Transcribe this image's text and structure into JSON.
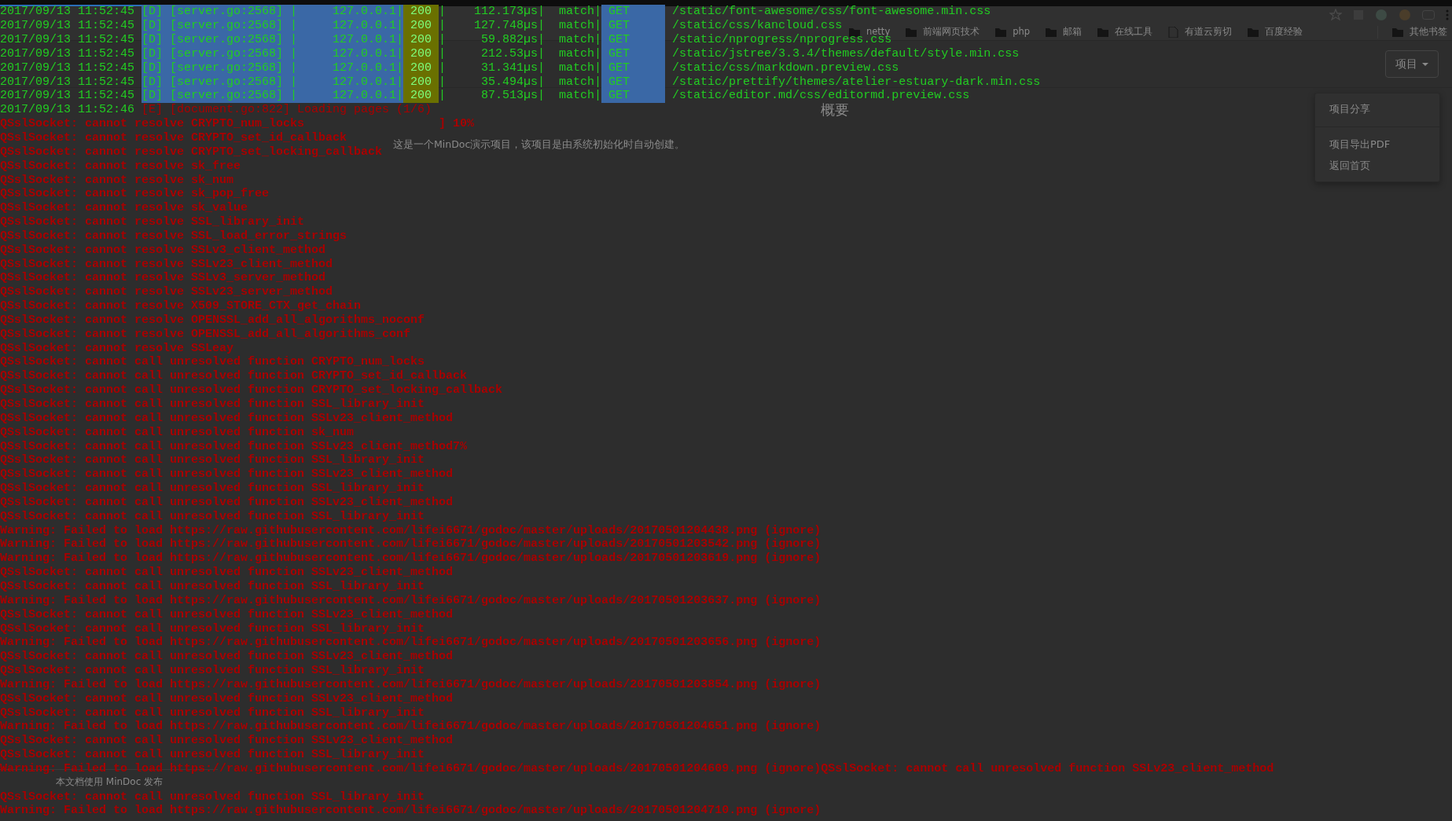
{
  "browser": {
    "bookmarks": [
      {
        "kind": "folder",
        "label": "netty"
      },
      {
        "kind": "folder",
        "label": "前端网页技术"
      },
      {
        "kind": "folder",
        "label": "php"
      },
      {
        "kind": "folder",
        "label": "邮箱"
      },
      {
        "kind": "folder",
        "label": "在线工具"
      },
      {
        "kind": "page",
        "label": "有道云剪切"
      },
      {
        "kind": "folder",
        "label": "百度经验"
      }
    ],
    "other_bookmarks": "其他书签",
    "project_button": "项目",
    "menu": [
      {
        "kind": "item",
        "label": "项目分享"
      },
      {
        "kind": "divider"
      },
      {
        "kind": "item",
        "label": "项目导出PDF"
      },
      {
        "kind": "item",
        "label": "返回首页"
      }
    ],
    "heading": "概要",
    "description": "这是一个MinDoc演示项目，该项目是由系统初始化时自动创建。",
    "footer": "本文档使用 MinDoc 发布"
  },
  "terminal": {
    "lines": [
      {
        "kind": "request",
        "time": "2017/09/13 11:52:45",
        "source": "[D] [server.go:2568] |     127.0.0.1|",
        "status": "200",
        "timing": "|    112.173µs|",
        "route": "match|",
        "method": "GET",
        "path": "/static/font-awesome/css/font-awesome.min.css"
      },
      {
        "kind": "request",
        "time": "2017/09/13 11:52:45",
        "source": "[D] [server.go:2568] |     127.0.0.1|",
        "status": "200",
        "timing": "|    127.748µs|",
        "route": "match|",
        "method": "GET",
        "path": "/static/css/kancloud.css"
      },
      {
        "kind": "request",
        "time": "2017/09/13 11:52:45",
        "source": "[D] [server.go:2568] |     127.0.0.1|",
        "status": "200",
        "timing": "|     59.882µs|",
        "route": "match|",
        "method": "GET",
        "path": "/static/nprogress/nprogress.css"
      },
      {
        "kind": "request",
        "time": "2017/09/13 11:52:45",
        "source": "[D] [server.go:2568] |     127.0.0.1|",
        "status": "200",
        "timing": "|     212.53µs|",
        "route": "match|",
        "method": "GET",
        "path": "/static/jstree/3.3.4/themes/default/style.min.css"
      },
      {
        "kind": "request",
        "time": "2017/09/13 11:52:45",
        "source": "[D] [server.go:2568] |     127.0.0.1|",
        "status": "200",
        "timing": "|     31.341µs|",
        "route": "match|",
        "method": "GET",
        "path": "/static/css/markdown.preview.css"
      },
      {
        "kind": "request",
        "time": "2017/09/13 11:52:45",
        "source": "[D] [server.go:2568] |     127.0.0.1|",
        "status": "200",
        "timing": "|     35.494µs|",
        "route": "match|",
        "method": "GET",
        "path": "/static/prettify/themes/atelier-estuary-dark.min.css"
      },
      {
        "kind": "request",
        "time": "2017/09/13 11:52:45",
        "source": "[D] [server.go:2568] |     127.0.0.1|",
        "status": "200",
        "timing": "|     87.513µs|",
        "route": "match|",
        "method": "GET",
        "path": "/static/editor.md/css/editormd.preview.css"
      },
      {
        "kind": "notice",
        "time": "2017/09/13 11:52:46",
        "text": "[E] [document.go:822] Loading pages (1/6)"
      },
      {
        "kind": "error",
        "text": "QSslSocket: cannot resolve CRYPTO_num_locks                   ] 10%"
      },
      {
        "kind": "error",
        "text": "QSslSocket: cannot resolve CRYPTO_set_id_callback"
      },
      {
        "kind": "error",
        "text": "QSslSocket: cannot resolve CRYPTO_set_locking_callback"
      },
      {
        "kind": "error",
        "text": "QSslSocket: cannot resolve sk_free"
      },
      {
        "kind": "error",
        "text": "QSslSocket: cannot resolve sk_num"
      },
      {
        "kind": "error",
        "text": "QSslSocket: cannot resolve sk_pop_free"
      },
      {
        "kind": "error",
        "text": "QSslSocket: cannot resolve sk_value"
      },
      {
        "kind": "error",
        "text": "QSslSocket: cannot resolve SSL_library_init"
      },
      {
        "kind": "error",
        "text": "QSslSocket: cannot resolve SSL_load_error_strings"
      },
      {
        "kind": "error",
        "text": "QSslSocket: cannot resolve SSLv3_client_method"
      },
      {
        "kind": "error",
        "text": "QSslSocket: cannot resolve SSLv23_client_method"
      },
      {
        "kind": "error",
        "text": "QSslSocket: cannot resolve SSLv3_server_method"
      },
      {
        "kind": "error",
        "text": "QSslSocket: cannot resolve SSLv23_server_method"
      },
      {
        "kind": "error",
        "text": "QSslSocket: cannot resolve X509_STORE_CTX_get_chain"
      },
      {
        "kind": "error",
        "text": "QSslSocket: cannot resolve OPENSSL_add_all_algorithms_noconf"
      },
      {
        "kind": "error",
        "text": "QSslSocket: cannot resolve OPENSSL_add_all_algorithms_conf"
      },
      {
        "kind": "error",
        "text": "QSslSocket: cannot resolve SSLeay"
      },
      {
        "kind": "error",
        "text": "QSslSocket: cannot call unresolved function CRYPTO_num_locks"
      },
      {
        "kind": "error",
        "text": "QSslSocket: cannot call unresolved function CRYPTO_set_id_callback"
      },
      {
        "kind": "error",
        "text": "QSslSocket: cannot call unresolved function CRYPTO_set_locking_callback"
      },
      {
        "kind": "error",
        "text": "QSslSocket: cannot call unresolved function SSL_library_init"
      },
      {
        "kind": "error",
        "text": "QSslSocket: cannot call unresolved function SSLv23_client_method"
      },
      {
        "kind": "error",
        "text": "QSslSocket: cannot call unresolved function sk_num"
      },
      {
        "kind": "error",
        "text": "QSslSocket: cannot call unresolved function SSLv23_client_method7%"
      },
      {
        "kind": "error",
        "text": "QSslSocket: cannot call unresolved function SSL_library_init"
      },
      {
        "kind": "error",
        "text": "QSslSocket: cannot call unresolved function SSLv23_client_method"
      },
      {
        "kind": "error",
        "text": "QSslSocket: cannot call unresolved function SSL_library_init"
      },
      {
        "kind": "error",
        "text": "QSslSocket: cannot call unresolved function SSLv23_client_method"
      },
      {
        "kind": "error",
        "text": "QSslSocket: cannot call unresolved function SSL_library_init"
      },
      {
        "kind": "error",
        "text": "Warning: Failed to load https://raw.githubusercontent.com/lifei6671/godoc/master/uploads/20170501204438.png (ignore)"
      },
      {
        "kind": "error",
        "text": "Warning: Failed to load https://raw.githubusercontent.com/lifei6671/godoc/master/uploads/20170501203542.png (ignore)"
      },
      {
        "kind": "error",
        "text": "Warning: Failed to load https://raw.githubusercontent.com/lifei6671/godoc/master/uploads/20170501203619.png (ignore)"
      },
      {
        "kind": "error",
        "text": "QSslSocket: cannot call unresolved function SSLv23_client_method"
      },
      {
        "kind": "error",
        "text": "QSslSocket: cannot call unresolved function SSL_library_init"
      },
      {
        "kind": "error",
        "text": "Warning: Failed to load https://raw.githubusercontent.com/lifei6671/godoc/master/uploads/20170501203637.png (ignore)"
      },
      {
        "kind": "error",
        "text": "QSslSocket: cannot call unresolved function SSLv23_client_method"
      },
      {
        "kind": "error",
        "text": "QSslSocket: cannot call unresolved function SSL_library_init"
      },
      {
        "kind": "error",
        "text": "Warning: Failed to load https://raw.githubusercontent.com/lifei6671/godoc/master/uploads/20170501203656.png (ignore)"
      },
      {
        "kind": "error",
        "text": "QSslSocket: cannot call unresolved function SSLv23_client_method"
      },
      {
        "kind": "error",
        "text": "QSslSocket: cannot call unresolved function SSL_library_init"
      },
      {
        "kind": "error",
        "text": "Warning: Failed to load https://raw.githubusercontent.com/lifei6671/godoc/master/uploads/20170501203854.png (ignore)"
      },
      {
        "kind": "error",
        "text": "QSslSocket: cannot call unresolved function SSLv23_client_method"
      },
      {
        "kind": "error",
        "text": "QSslSocket: cannot call unresolved function SSL_library_init"
      },
      {
        "kind": "error",
        "text": "Warning: Failed to load https://raw.githubusercontent.com/lifei6671/godoc/master/uploads/20170501204651.png (ignore)"
      },
      {
        "kind": "error",
        "text": "QSslSocket: cannot call unresolved function SSLv23_client_method"
      },
      {
        "kind": "error",
        "text": "QSslSocket: cannot call unresolved function SSL_library_init"
      },
      {
        "kind": "error",
        "text": "Warning: Failed to load https://raw.githubusercontent.com/lifei6671/godoc/master/uploads/20170501204609.png (ignore)QSslSocket: cannot call unresolved function SSLv23_client_method"
      },
      {
        "kind": "blank"
      },
      {
        "kind": "error",
        "text": "QSslSocket: cannot call unresolved function SSL_library_init"
      },
      {
        "kind": "error",
        "text": "Warning: Failed to load https://raw.githubusercontent.com/lifei6671/godoc/master/uploads/20170501204710.png (ignore)"
      }
    ]
  }
}
